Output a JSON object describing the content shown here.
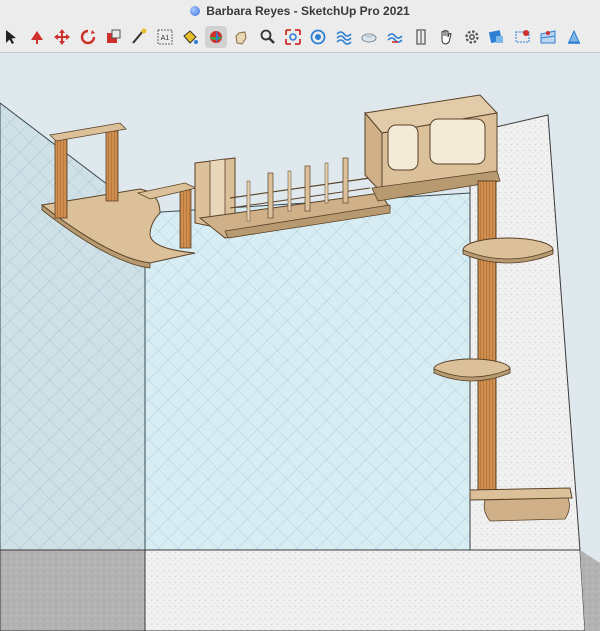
{
  "window": {
    "title": "Barbara Reyes - SketchUp Pro 2021",
    "doc_icon": "sketchup-doc-icon"
  },
  "toolbar": {
    "active_index": 8,
    "tools": [
      {
        "name": "select-tool",
        "icon": "arrow-icon"
      },
      {
        "name": "push-pull-tool",
        "icon": "push-pull-icon"
      },
      {
        "name": "move-tool",
        "icon": "move-icon"
      },
      {
        "name": "rotate-tool",
        "icon": "rotate-icon"
      },
      {
        "name": "scale-tool",
        "icon": "scale-icon"
      },
      {
        "name": "tape-measure-tool",
        "icon": "tape-measure-icon"
      },
      {
        "name": "text-tool",
        "icon": "text-icon",
        "glyph": "A1"
      },
      {
        "name": "paint-bucket-tool",
        "icon": "paint-bucket-icon"
      },
      {
        "name": "orbit-tool",
        "icon": "orbit-icon"
      },
      {
        "name": "pan-tool",
        "icon": "pan-icon"
      },
      {
        "name": "zoom-tool",
        "icon": "zoom-icon"
      },
      {
        "name": "zoom-extents-tool",
        "icon": "zoom-extents-icon"
      },
      {
        "name": "previous-view-tool",
        "icon": "previous-view-icon"
      },
      {
        "name": "sandbox-tool",
        "icon": "sandbox-icon"
      },
      {
        "name": "smoove-tool",
        "icon": "smoove-icon"
      },
      {
        "name": "stamp-tool",
        "icon": "stamp-icon"
      },
      {
        "name": "section-plane-tool",
        "icon": "section-plane-icon"
      },
      {
        "name": "hand-tool",
        "icon": "hand-icon"
      },
      {
        "name": "settings-tool",
        "icon": "gear-icon"
      },
      {
        "name": "model-info-tool",
        "icon": "model-info-icon"
      },
      {
        "name": "add-location-tool",
        "icon": "location-icon"
      },
      {
        "name": "terrain-tool",
        "icon": "terrain-icon"
      },
      {
        "name": "export-tool",
        "icon": "export-icon"
      }
    ]
  },
  "colors": {
    "wood": "#dcc09a",
    "wood_edge": "#8a6a42",
    "post": "#c8894a",
    "glass_left": "#c9dde6",
    "glass_back": "#d6ecf2",
    "wall_plaster": "#efefef",
    "floor_gray": "#b8b8b8",
    "accent_blue": "#2f7fd4",
    "accent_red": "#d0302c"
  }
}
